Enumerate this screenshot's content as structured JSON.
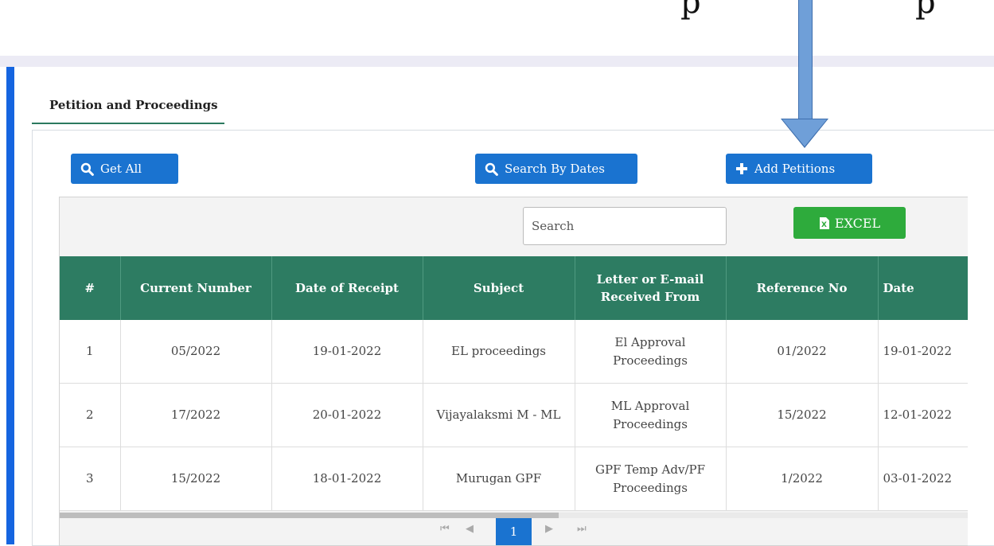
{
  "tab": {
    "label": "Petition and Proceedings"
  },
  "buttons": {
    "get_all": "Get All",
    "search_by_dates": "Search By Dates",
    "add_petitions": "Add Petitions",
    "excel": "EXCEL"
  },
  "search": {
    "placeholder": "Search",
    "value": ""
  },
  "table": {
    "columns": [
      "#",
      "Current Number",
      "Date of Receipt",
      "Subject",
      "Letter or E-mail Received From",
      "Reference No",
      "Date"
    ],
    "rows": [
      [
        "1",
        "05/2022",
        "19-01-2022",
        "EL proceedings",
        "El Approval Proceedings",
        "01/2022",
        "19-01-2022"
      ],
      [
        "2",
        "17/2022",
        "20-01-2022",
        "Vijayalaksmi M - ML",
        "ML Approval Proceedings",
        "15/2022",
        "12-01-2022"
      ],
      [
        "3",
        "15/2022",
        "18-01-2022",
        "Murugan GPF",
        "GPF Temp Adv/PF Proceedings",
        "1/2022",
        "03-01-2022"
      ]
    ]
  },
  "pager": {
    "current_page": "1",
    "first": "⏮",
    "prev": "◀",
    "next": "▶",
    "last": "⏭"
  },
  "top_fragment": {
    "left": "p",
    "right": "p"
  },
  "colors": {
    "header_green": "#2d7c62",
    "button_blue": "#1a73d0",
    "excel_green": "#2eab3c"
  }
}
